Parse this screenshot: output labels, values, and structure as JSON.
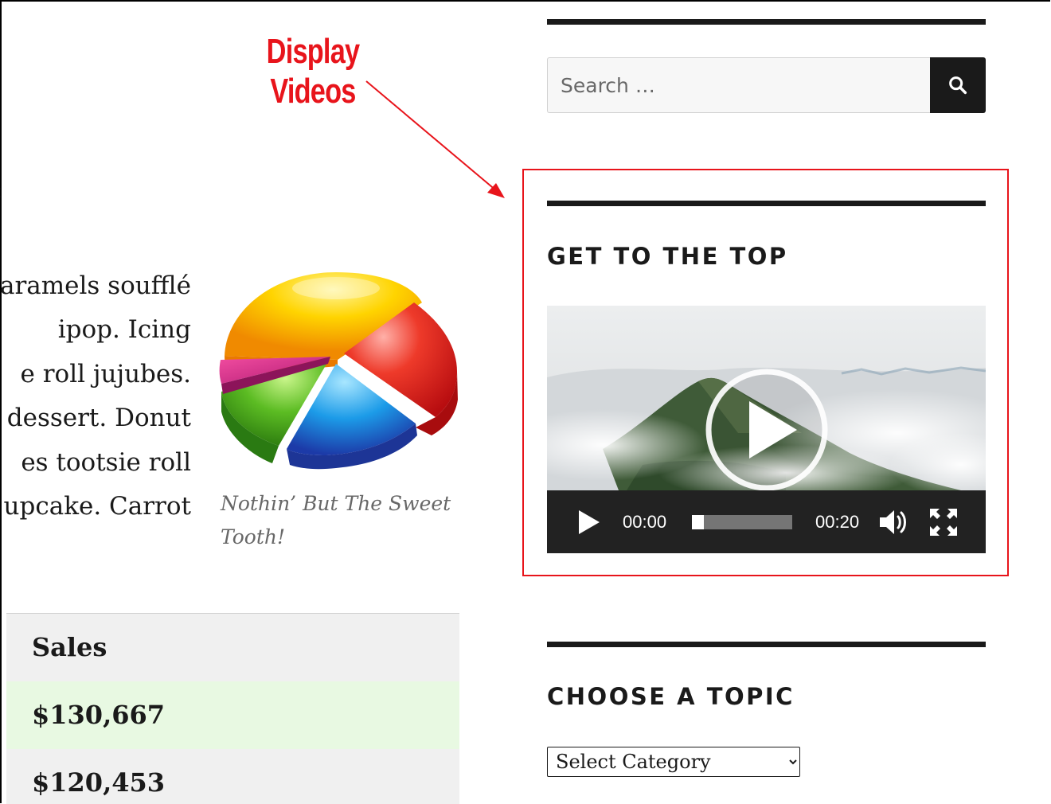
{
  "annotation": {
    "label_line1": "Display",
    "label_line2": "Videos",
    "color": "#e8141b"
  },
  "content": {
    "heading_fragment": ":",
    "body_lines": [
      "aramels soufflé",
      "ipop. Icing",
      "e roll jujubes.",
      "dessert. Donut",
      "es tootsie roll",
      "upcake. Carrot"
    ],
    "figure_caption": "Nothin’ But The Sweet Tooth!"
  },
  "table": {
    "header": "Sales",
    "rows": [
      "$130,667",
      "$120,453"
    ],
    "row_colors": [
      "#e8f9e2",
      "#f0f0f0"
    ]
  },
  "sidebar": {
    "search": {
      "placeholder": "Search …",
      "button_icon": "search-icon"
    },
    "video_widget": {
      "title": "GET TO THE TOP",
      "current_time": "00:00",
      "duration": "00:20",
      "progress_fraction": 0.12,
      "icons": [
        "play-icon",
        "volume-icon",
        "fullscreen-icon"
      ]
    },
    "category_widget": {
      "title": "CHOOSE A TOPIC",
      "select_value": "Select Category"
    }
  }
}
